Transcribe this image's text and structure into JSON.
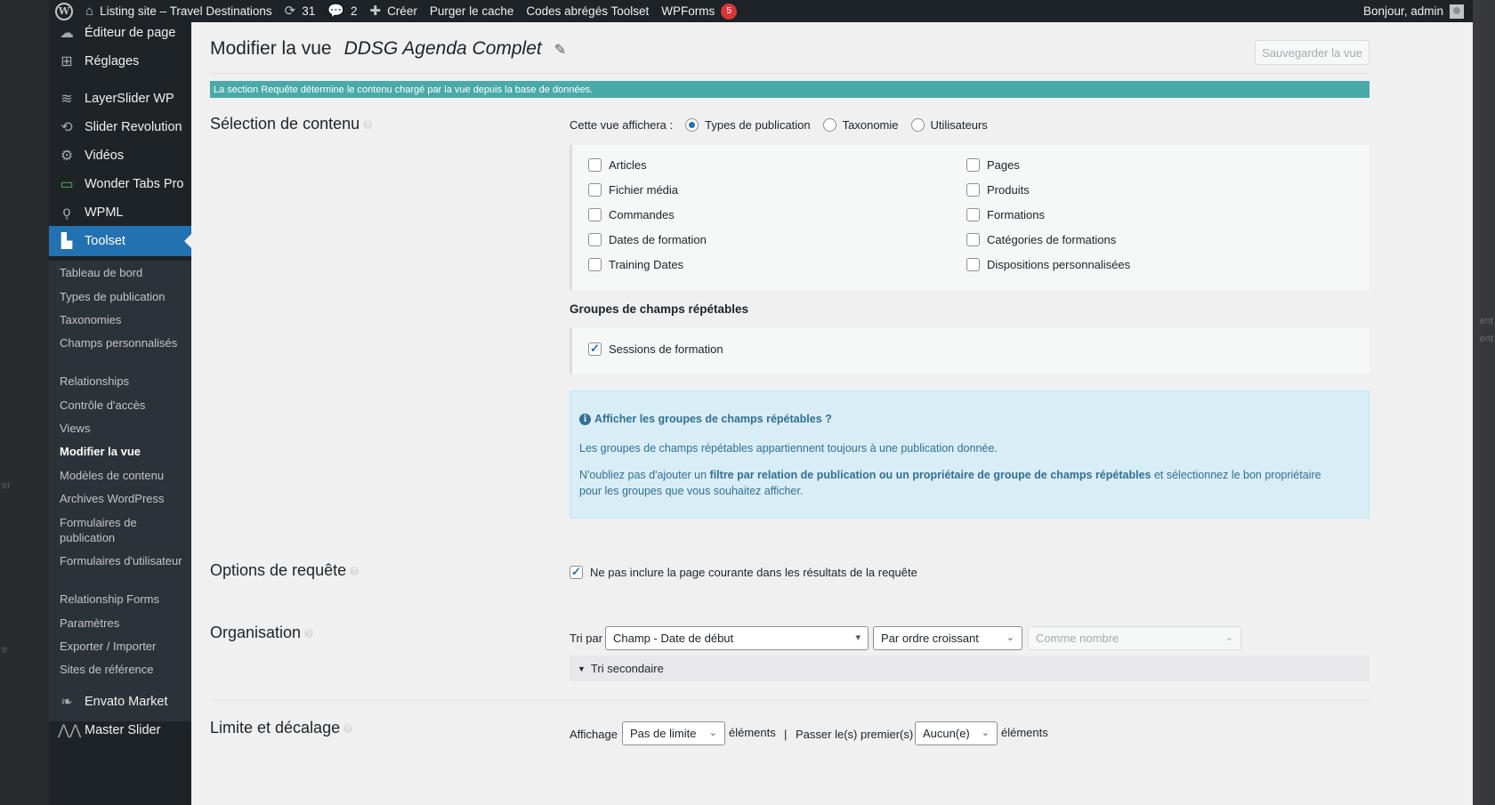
{
  "admin_bar": {
    "site_name": "Listing site – Travel Destinations",
    "updates_count": "31",
    "comments_count": "2",
    "create": "Créer",
    "purge_cache": "Purger le cache",
    "toolset_shortcodes": "Codes abrégés Toolset",
    "wpforms": "WPForms",
    "wpforms_badge": "5",
    "greeting": "Bonjour, admin"
  },
  "sidebar": {
    "top_items": [
      {
        "label": "Éditeur de page",
        "icon": "page-editor-icon"
      },
      {
        "label": "Réglages",
        "icon": "settings-icon"
      },
      {
        "label": "LayerSlider WP",
        "icon": "layers-icon"
      },
      {
        "label": "Slider Revolution",
        "icon": "refresh-icon"
      },
      {
        "label": "Vidéos",
        "icon": "gear-icon"
      },
      {
        "label": "Wonder Tabs Pro",
        "icon": "folder-icon"
      },
      {
        "label": "WPML",
        "icon": "wpml-icon"
      },
      {
        "label": "Toolset",
        "icon": "toolset-icon"
      }
    ],
    "submenu": [
      "Tableau de bord",
      "Types de publication",
      "Taxonomies",
      "Champs personnalisés",
      "Relationships",
      "Contrôle d'accès",
      "Views",
      "Modifier la vue",
      "Modèles de contenu",
      "Archives WordPress",
      "Formulaires de publication",
      "Formulaires d'utilisateur",
      "Relationship Forms",
      "Paramètres",
      "Exporter / Importer",
      "Sites de référence"
    ],
    "bottom_items": [
      {
        "label": "Envato Market",
        "icon": "envato-icon"
      },
      {
        "label": "Master Slider",
        "icon": "master-slider-icon"
      }
    ]
  },
  "header": {
    "title": "Modifier la vue",
    "view_name": "DDSG Agenda Complet",
    "save_button": "Sauvegarder la vue"
  },
  "notice": "La section Requête détermine le contenu chargé par la vue depuis la base de données.",
  "content_selection": {
    "title": "Sélection de contenu",
    "display_label": "Cette vue affichera :",
    "radio_options": [
      "Types de publication",
      "Taxonomie",
      "Utilisateurs"
    ],
    "selected_radio": "Types de publication",
    "post_types_left": [
      "Articles",
      "Fichier média",
      "Commandes",
      "Dates de formation",
      "Training Dates"
    ],
    "post_types_right": [
      "Pages",
      "Produits",
      "Formations",
      "Catégories de formations",
      "Dispositions personnalisées"
    ],
    "repeatable_groups_title": "Groupes de champs répétables",
    "repeatable_group_item": "Sessions de formation",
    "info": {
      "heading": "Afficher les groupes de champs répétables ?",
      "line1": "Les groupes de champs répétables appartiennent toujours à une publication donnée.",
      "line2_pre": "N'oubliez pas d'ajouter un ",
      "line2_bold": "filtre par relation de publication ou un propriétaire de groupe de champs répétables",
      "line2_post": " et sélectionnez le bon propriétaire",
      "line3": "pour les groupes que vous souhaitez afficher."
    }
  },
  "query_options": {
    "title": "Options de requête",
    "exclude_current": "Ne pas inclure la page courante dans les résultats de la requête"
  },
  "organisation": {
    "title": "Organisation",
    "sort_by_label": "Tri par",
    "sort_field": "Champ - Date de début",
    "sort_order": "Par ordre croissant",
    "sort_as": "Comme nombre",
    "secondary_sort": "Tri secondaire"
  },
  "limit_offset": {
    "title": "Limite et décalage",
    "display_label": "Affichage",
    "limit_value": "Pas de limite",
    "items_label": "éléments",
    "separator": "|",
    "skip_label": "Passer le(s) premier(s)",
    "skip_value": "Aucun(e)",
    "items_label2": "éléments"
  },
  "colors": {
    "accent": "#2271b1",
    "notice": "#4aa9a9",
    "info_bg": "#d9edf7",
    "sidebar": "#1d2327"
  }
}
